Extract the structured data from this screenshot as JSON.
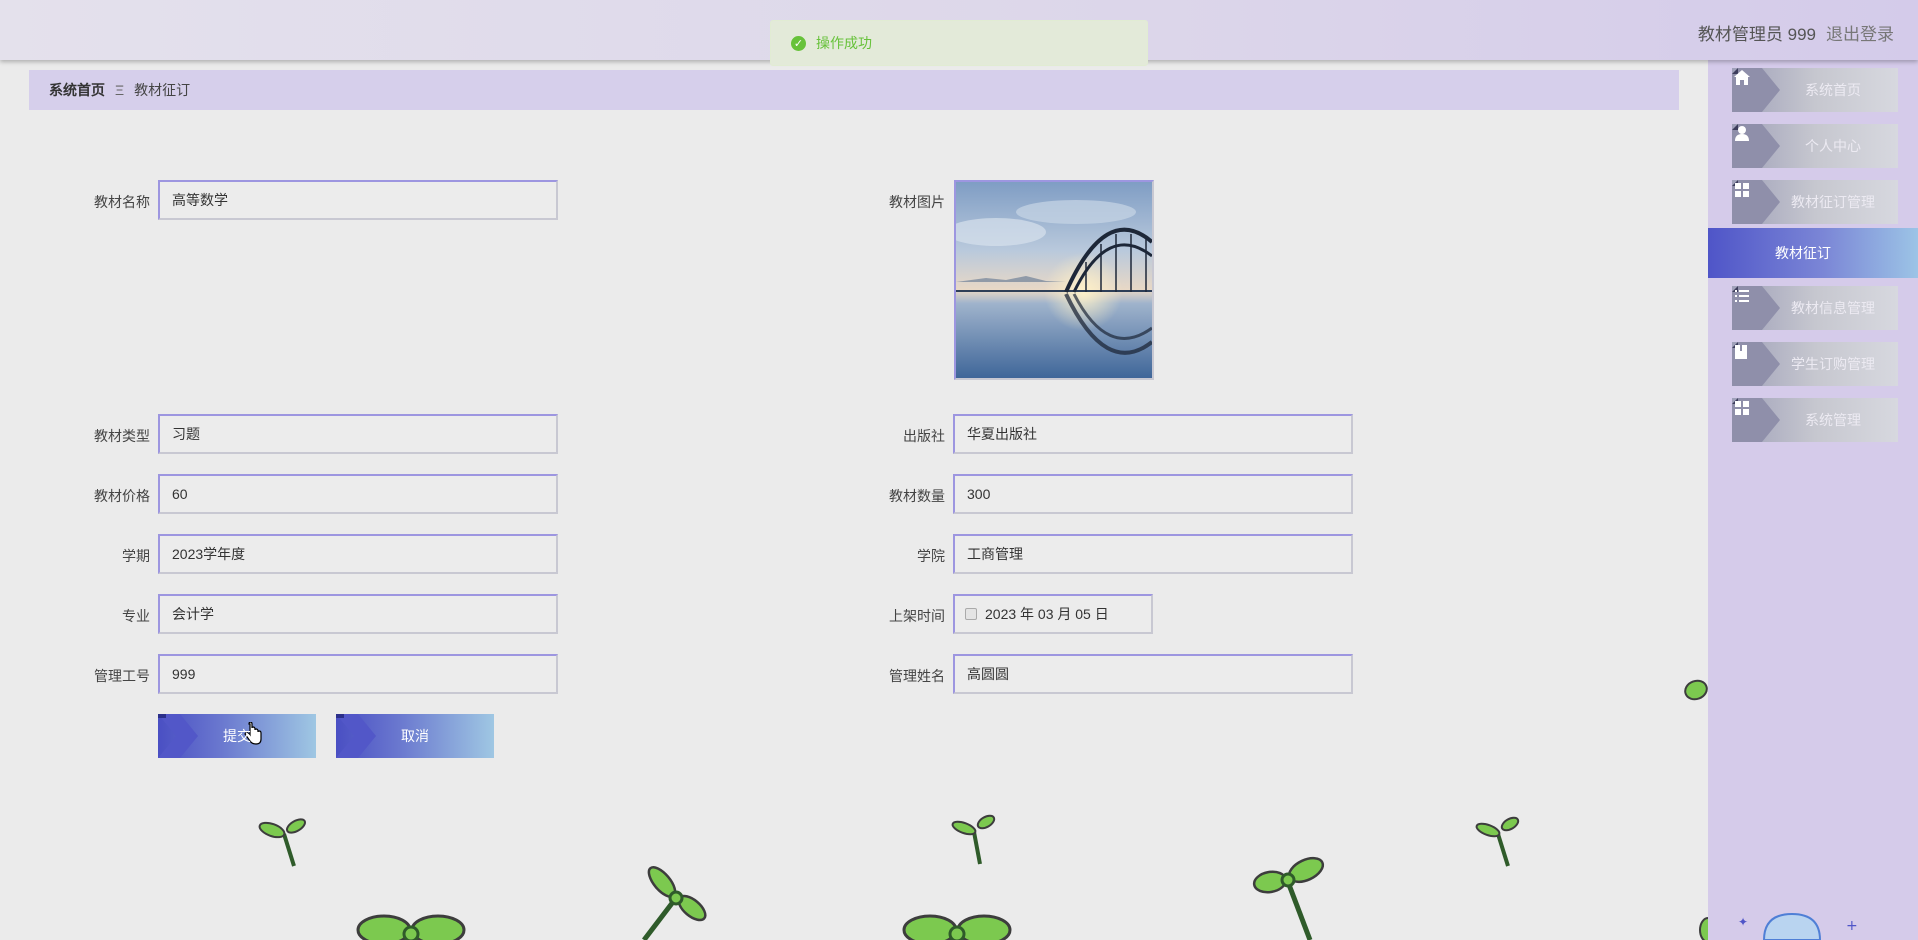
{
  "header": {
    "user": "教材管理员 999",
    "logout": "退出登录"
  },
  "toast": {
    "message": "操作成功",
    "icon": "check-circle-icon",
    "color": "#67c23a"
  },
  "breadcrumb": {
    "home": "系统首页",
    "separator": "Ξ",
    "current": "教材征订"
  },
  "form": {
    "name_label": "教材名称",
    "name_value": "高等数学",
    "image_label": "教材图片",
    "type_label": "教材类型",
    "type_value": "习题",
    "publisher_label": "出版社",
    "publisher_value": "华夏出版社",
    "price_label": "教材价格",
    "price_value": "60",
    "quantity_label": "教材数量",
    "quantity_value": "300",
    "semester_label": "学期",
    "semester_value": "2023学年度",
    "college_label": "学院",
    "college_value": "工商管理",
    "major_label": "专业",
    "major_value": "会计学",
    "date_label": "上架时间",
    "date_value": "2023 年 03 月 05 日",
    "manager_id_label": "管理工号",
    "manager_id_value": "999",
    "manager_name_label": "管理姓名",
    "manager_name_value": "高圆圆",
    "submit_label": "提交",
    "cancel_label": "取消"
  },
  "sidebar": {
    "items": [
      {
        "label": "系统首页",
        "icon": "home-icon"
      },
      {
        "label": "个人中心",
        "icon": "user-icon"
      },
      {
        "label": "教材征订管理",
        "icon": "grid-icon"
      },
      {
        "label": "教材征订",
        "icon": "",
        "active": true
      },
      {
        "label": "教材信息管理",
        "icon": "list-icon"
      },
      {
        "label": "学生订购管理",
        "icon": "book-icon"
      },
      {
        "label": "系统管理",
        "icon": "grid-icon"
      }
    ]
  },
  "colors": {
    "accent": "#4f55c8",
    "sidebar_bg": "#d5cbea",
    "breadcrumb_bg": "#d6cfeb",
    "page_bg": "#ebebeb"
  }
}
